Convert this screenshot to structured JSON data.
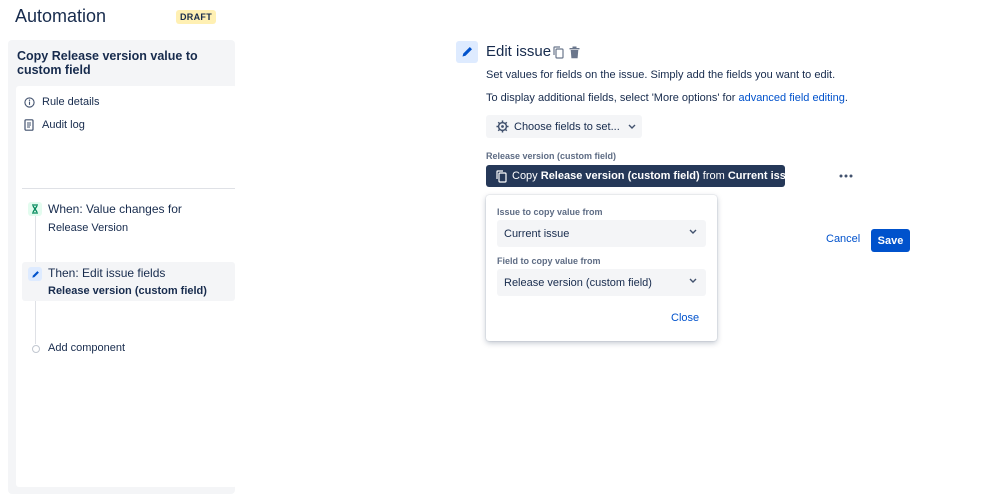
{
  "header": {
    "title": "Automation",
    "badge": "DRAFT"
  },
  "sidebar": {
    "rule_name": "Copy Release version value to custom field",
    "nav": [
      {
        "label": "Rule details",
        "icon": "info-icon"
      },
      {
        "label": "Audit log",
        "icon": "document-icon"
      }
    ],
    "steps": [
      {
        "title": "When: Value changes for",
        "subtitle": "Release Version",
        "icon": "trigger-icon"
      },
      {
        "title": "Then: Edit issue fields",
        "subtitle": "Release version (custom field)",
        "icon": "pencil-icon"
      }
    ],
    "add_component": "Add component"
  },
  "main": {
    "title": "Edit issue",
    "desc1": "Set values for fields on the issue. Simply add the fields you want to edit.",
    "desc2_prefix": "To display additional fields, select 'More options' for ",
    "desc2_link": "advanced field editing",
    "desc2_suffix": ".",
    "choose_fields": "Choose fields to set...",
    "field_label": "Release version (custom field)",
    "chip": {
      "prefix": "Copy ",
      "field": "Release version (custom field)",
      "middle": " from ",
      "source": "Current issue"
    },
    "popup": {
      "issue_label": "Issue to copy value from",
      "issue_value": "Current issue",
      "field_label": "Field to copy value from",
      "field_value": "Release version (custom field)",
      "close": "Close"
    },
    "cancel": "Cancel",
    "save": "Save"
  },
  "colors": {
    "accent": "#0052cc",
    "chip_bg": "#253858",
    "badge_bg": "#fff0b3",
    "trigger_bg": "#e3fcef",
    "edit_bg": "#deebff"
  }
}
